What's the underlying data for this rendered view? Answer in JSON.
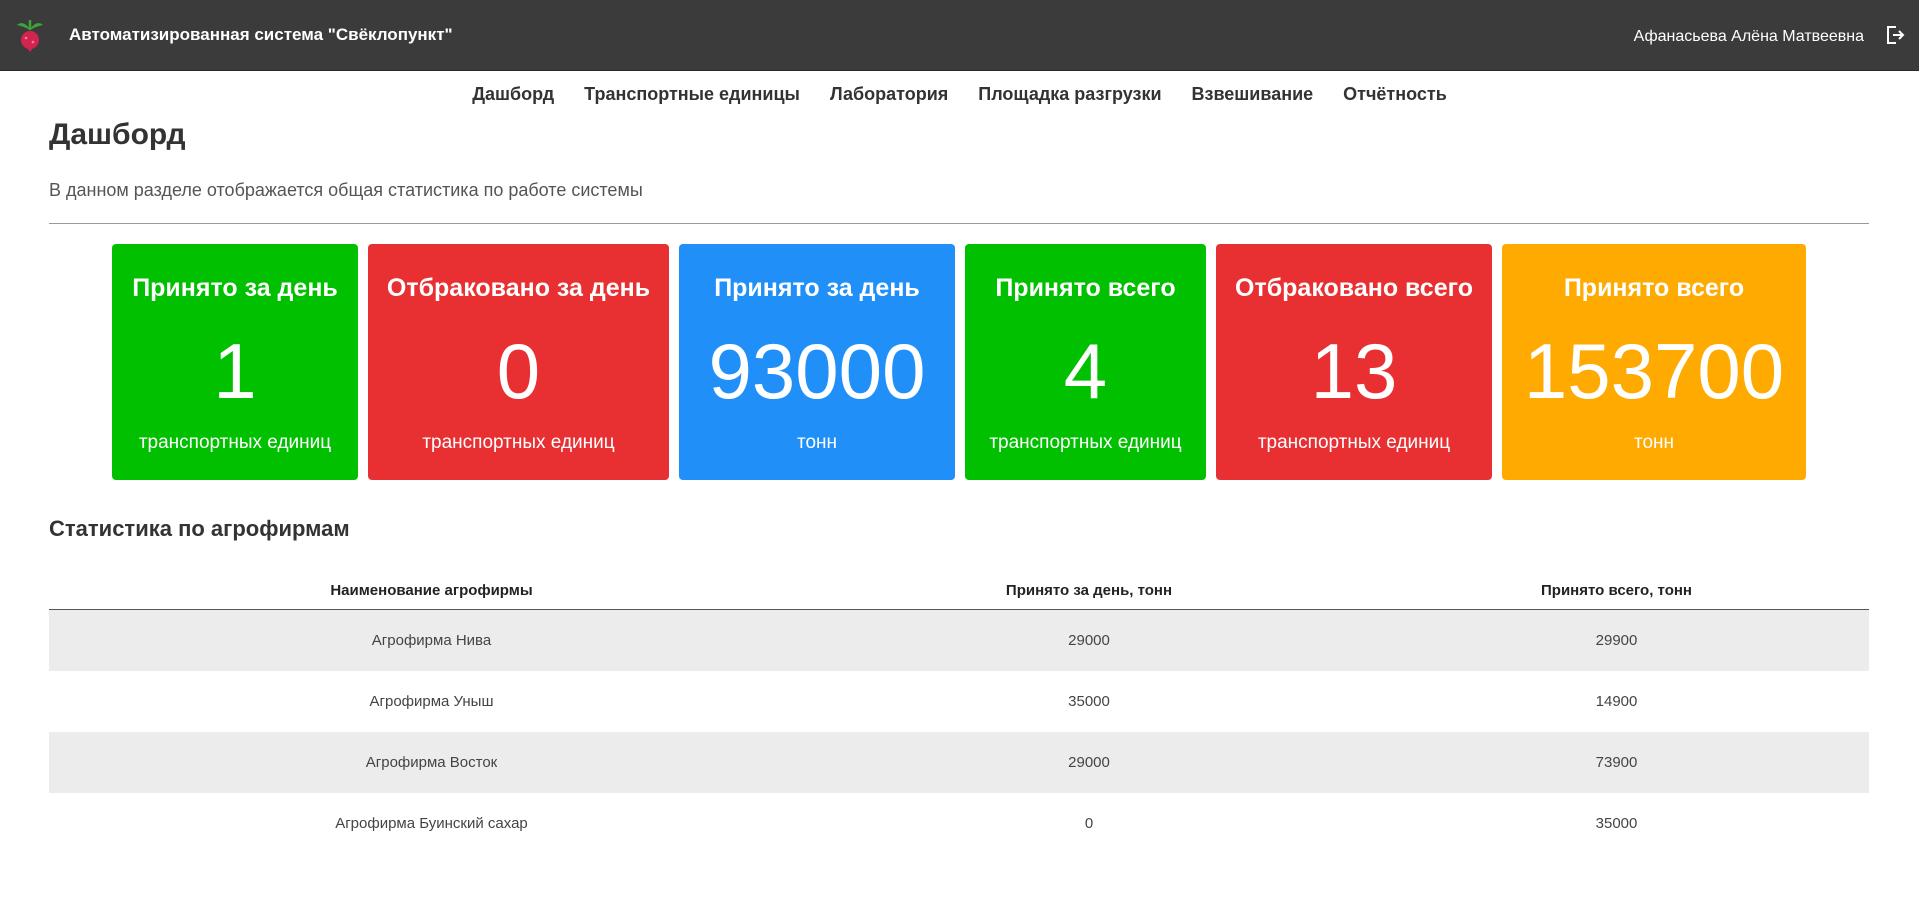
{
  "header": {
    "app_title": "Автоматизированная система \"Свёклопункт\"",
    "user_name": "Афанасьева Алёна Матвеевна",
    "logo_icon": "beet-icon",
    "logout_icon": "logout-icon"
  },
  "nav": {
    "items": [
      {
        "label": "Дашборд"
      },
      {
        "label": "Транспортные единицы"
      },
      {
        "label": "Лаборатория"
      },
      {
        "label": "Площадка разгрузки"
      },
      {
        "label": "Взвешивание"
      },
      {
        "label": "Отчётность"
      }
    ]
  },
  "page": {
    "title": "Дашборд",
    "subtitle": "В данном разделе отображается общая статистика по работе системы"
  },
  "cards": [
    {
      "title": "Принято за день",
      "value": "1",
      "unit": "транспортных единиц",
      "color": "#00c000"
    },
    {
      "title": "Отбраковано за день",
      "value": "0",
      "unit": "транспортных единиц",
      "color": "#e83033"
    },
    {
      "title": "Принято за день",
      "value": "93000",
      "unit": "тонн",
      "color": "#2090f8"
    },
    {
      "title": "Принято всего",
      "value": "4",
      "unit": "транспортных единиц",
      "color": "#00c000"
    },
    {
      "title": "Отбраковано всего",
      "value": "13",
      "unit": "транспортных единиц",
      "color": "#e83033"
    },
    {
      "title": "Принято всего",
      "value": "153700",
      "unit": "тонн",
      "color": "#ffaa00"
    }
  ],
  "stats": {
    "title": "Статистика по агрофирмам",
    "columns": [
      "Наименование агрофирмы",
      "Принято за день, тонн",
      "Принято всего, тонн"
    ],
    "rows": [
      [
        "Агрофирма Нива",
        "29000",
        "29900"
      ],
      [
        "Агрофирма Уныш",
        "35000",
        "14900"
      ],
      [
        "Агрофирма Восток",
        "29000",
        "73900"
      ],
      [
        "Агрофирма Буинский сахар",
        "0",
        "35000"
      ]
    ]
  }
}
